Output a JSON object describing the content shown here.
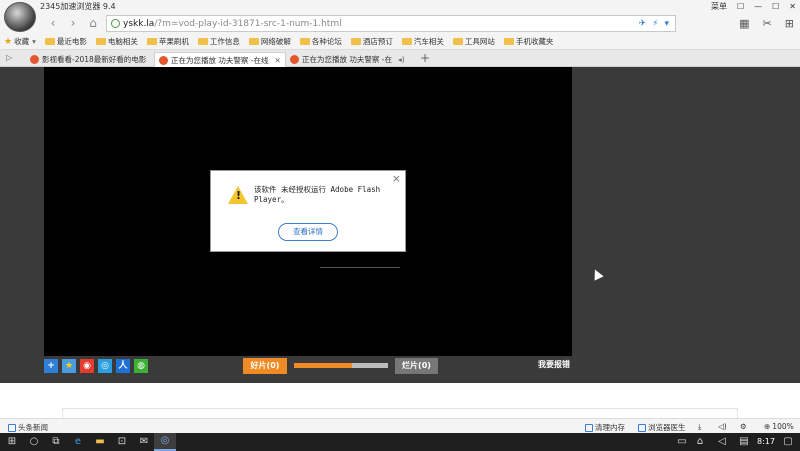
{
  "window": {
    "title": "2345加速浏览器 9.4",
    "controls": [
      "菜单",
      "☐",
      "—",
      "☐",
      "✕"
    ]
  },
  "address_bar": {
    "host": "yskk.la",
    "path": "/?m=vod-play-id-31871-src-1-num-1.html",
    "tools": [
      "✈",
      "⚡",
      "▾"
    ]
  },
  "bookmarks": {
    "fav_label": "收藏",
    "items": [
      "最近电影",
      "电脑相关",
      "苹果刷机",
      "工作信息",
      "网络破解",
      "各种论坛",
      "酒店预订",
      "汽车相关",
      "工具网站",
      "手机收藏夹"
    ]
  },
  "tabs": [
    {
      "label": "影视看看-2018最新好看的电影"
    },
    {
      "label": "正在为您播放 功夫警察 -在线"
    },
    {
      "label": "正在为您播放 功夫警察 -在"
    }
  ],
  "dialog": {
    "message": "该软件 未经授权运行 Adobe Flash Player。",
    "button": "查看详情",
    "close": "×"
  },
  "player_controls": {
    "good_label": "好片(0)",
    "bad_label": "烂片(0)",
    "report_label": "我要报错",
    "vote_fraction": 0.62
  },
  "status_bar": {
    "left": "头条新闻",
    "clean_memory": "清理内存",
    "browser_doctor": "浏览器医生",
    "zoom": "100%"
  },
  "taskbar": {
    "time": "8:17"
  },
  "colors": {
    "accent_orange": "#f08a24",
    "link_blue": "#2a6fc3",
    "warning_yellow": "#f3c531"
  }
}
